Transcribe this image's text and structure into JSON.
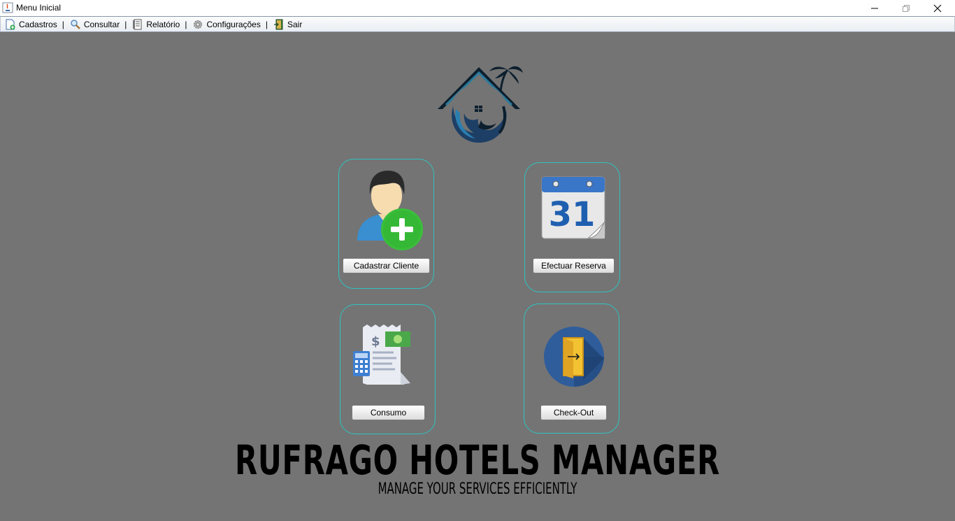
{
  "window": {
    "title": "Menu Inicial",
    "controls": [
      "minimize",
      "restore",
      "close"
    ]
  },
  "menubar": {
    "items": [
      {
        "label": "Cadastros",
        "icon": "new-document-icon"
      },
      {
        "label": "Consultar",
        "icon": "magnifier-icon"
      },
      {
        "label": "Relatório",
        "icon": "report-icon"
      },
      {
        "label": "Configurações",
        "icon": "gear-icon"
      },
      {
        "label": "Sair",
        "icon": "exit-door-icon"
      }
    ],
    "separator": "|"
  },
  "actions": {
    "cadastrar_cliente": "Cadastrar Cliente",
    "efectuar_reserva": "Efectuar Reserva",
    "consumo": "Consumo",
    "check_out": "Check-Out"
  },
  "calendar_day": "31",
  "brand": {
    "title": "RUFRAGO HOTELS MANAGER",
    "subtitle": "MANAGE YOUR SERVICES EFFICIENTLY"
  },
  "colors": {
    "background": "#747474",
    "card_border": "#2ec3c0",
    "brand_text": "#000000"
  }
}
